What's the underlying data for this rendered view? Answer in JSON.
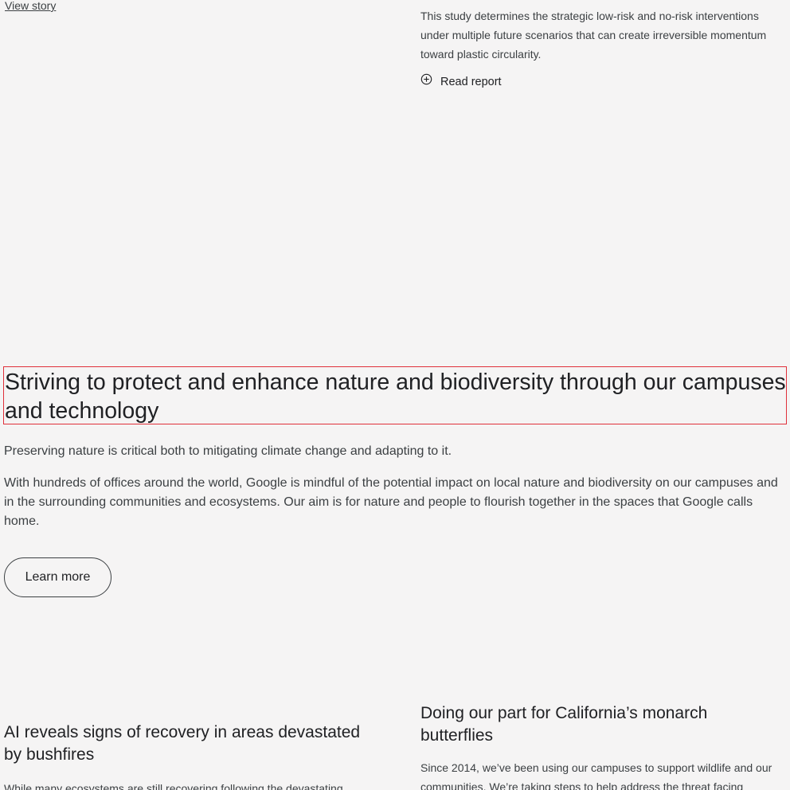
{
  "top_left": {
    "view_story_label": "View story"
  },
  "report": {
    "description": "This study determines the strategic low-risk and no-risk interventions under multiple future scenarios that can create irreversible momentum toward plastic circularity.",
    "read_report_label": "Read report",
    "icon": "plus-circle-icon"
  },
  "nature_section": {
    "heading": "Striving to protect and enhance nature and biodiversity through our campuses and technology",
    "lead": "Preserving nature is critical both to mitigating climate change and adapting to it.",
    "body": "With hundreds of offices around the world, Google is mindful of the potential impact on local nature and biodiversity on our campuses and in the surrounding communities and ecosystems. Our aim is for nature and people to flourish together in the spaces that Google calls home.",
    "learn_more_label": "Learn more"
  },
  "cards": {
    "left": {
      "title": "AI reveals signs of recovery in areas devastated by bushfires",
      "text": "While many ecosystems are still recovering following the devastating"
    },
    "right": {
      "title": "Doing our part for California’s monarch butterflies",
      "text": "Since 2014, we’ve been using our campuses to support wildlife and our communities. We’re taking steps to help address the threat facing California’s monarch butterflies."
    }
  },
  "colors": {
    "background": "#f5f4f4",
    "text": "#202124",
    "muted_text": "#3c4043",
    "highlight_border": "#e0303a"
  }
}
